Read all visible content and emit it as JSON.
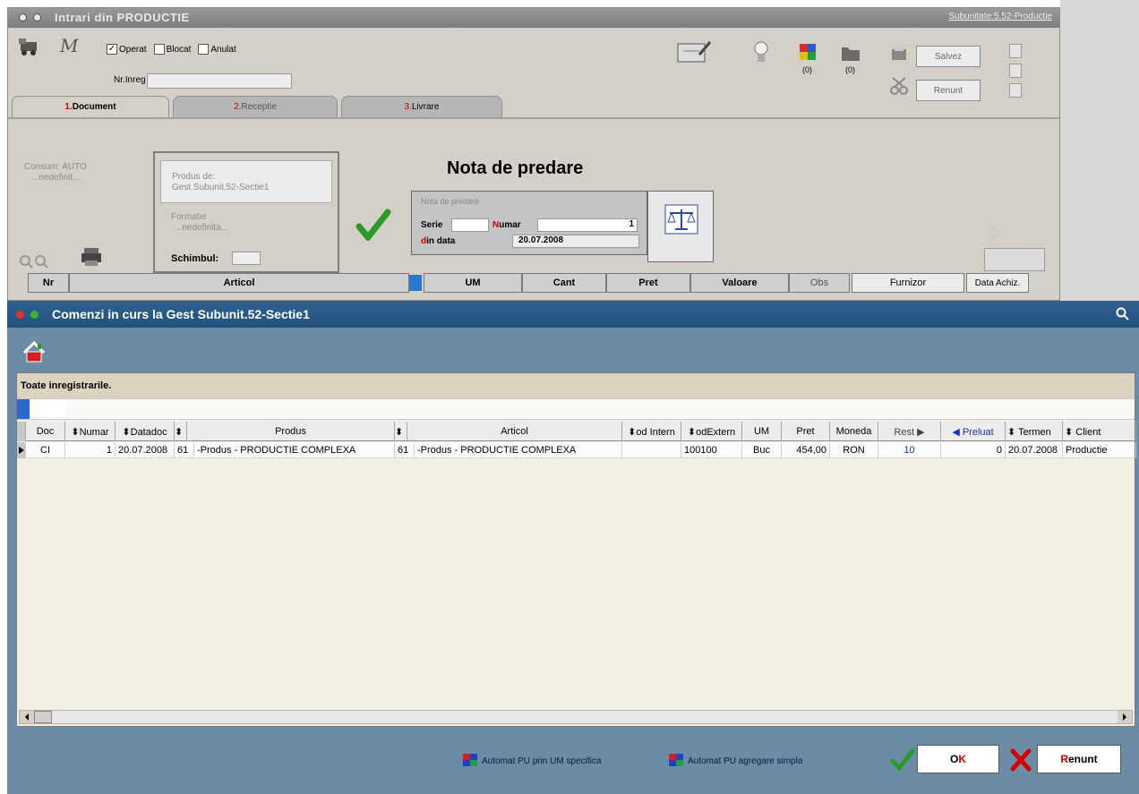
{
  "bg_window": {
    "title": "Intrari din PRODUCTIE",
    "subunit_link": "Subunitate:5.52-Productie",
    "checkboxes": [
      {
        "label": "Operat",
        "checked": true
      },
      {
        "label": "Blocat",
        "checked": false
      },
      {
        "label": "Anulat",
        "checked": false
      }
    ],
    "nr_inreg_label": "Nr.Inreg",
    "icon_counts": [
      "(0)",
      "(0)"
    ],
    "save_label": "Salvez",
    "cancel_label": "Renunt",
    "tabs": [
      {
        "num": "1.",
        "label": "Document"
      },
      {
        "num": "2.",
        "label": "Receptie"
      },
      {
        "num": "3.",
        "label": "Livrare"
      }
    ],
    "consum_line1": "Consum: AUTO",
    "consum_line2": "...nedefinit...",
    "produs_line1": "Produs de:",
    "produs_line2": "Gest Subunit.52-Sectie1",
    "formatie_line1": "Formatie",
    "formatie_line2": "...nedefinita...",
    "schimbul_label": "Schimbul:",
    "doc_heading": "Nota de predare",
    "doc_box_caption": "Nota de predare",
    "serie_label": "Serie",
    "numar_label_first": "N",
    "numar_label_rest": "umar",
    "numar_value": "1",
    "din_data_first": "d",
    "din_data_rest": "in data",
    "din_data_value": "20.07.2008",
    "grid_headers": [
      "Nr",
      "Articol",
      "UM",
      "Cant",
      "Pret",
      "Valoare",
      "Obs",
      "Furnizor",
      "Data Achiz."
    ]
  },
  "dialog": {
    "title": "Comenzi in curs la Gest Subunit.52-Sectie1",
    "caption": "Toate inregistrarile.",
    "columns": [
      {
        "label": "Doc"
      },
      {
        "label": "⬍Numar"
      },
      {
        "label": "⬍Datadoc"
      },
      {
        "label": "⬍"
      },
      {
        "label": "Produs"
      },
      {
        "label": "⬍"
      },
      {
        "label": "Articol"
      },
      {
        "label": "⬍od Intern"
      },
      {
        "label": "⬍odExtern"
      },
      {
        "label": "UM"
      },
      {
        "label": "Pret"
      },
      {
        "label": "Moneda"
      },
      {
        "label": "Rest ▶"
      },
      {
        "label": "◀ Preluat"
      },
      {
        "label": "⬍ Termen"
      },
      {
        "label": "⬍ Client"
      }
    ],
    "rows": [
      {
        "doc": "CI",
        "numar": "1",
        "datadoc": "20.07.2008",
        "cod_produs": "61",
        "produs": "-Produs - PRODUCTIE COMPLEXA",
        "cod_articol": "61",
        "articol": "-Produs - PRODUCTIE COMPLEXA",
        "cod_intern": "",
        "cod_extern": "100100",
        "um": "Buc",
        "pret": "454,00",
        "moneda": "RON",
        "rest": "10",
        "preluat": "0",
        "termen": "20.07.2008",
        "client": "Productie"
      }
    ],
    "footer": {
      "auto_um": "Automat PU prin UM specifica",
      "auto_simple": "Automat PU agregare simpla",
      "ok_first": "O",
      "ok_rest": "K",
      "cancel_first": "R",
      "cancel_rest": "enunt"
    }
  },
  "colors": {
    "dialog_bg": "#6c8ba7",
    "dialog_title": "#23517e",
    "grid_bg": "#f3f0e3",
    "accent_red": "#d00000",
    "check_green": "#2a9a2a",
    "rest_blue": "#2030c0"
  }
}
